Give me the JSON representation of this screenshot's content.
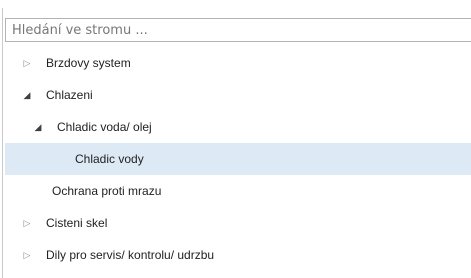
{
  "search": {
    "placeholder": "Hledání ve stromu ..."
  },
  "tree": {
    "rows": [
      {
        "label": "Brzdovy system",
        "expander": "▷"
      },
      {
        "label": "Chlazeni",
        "expander": "◢"
      },
      {
        "label": "Chladic voda/ olej",
        "expander": "◢"
      },
      {
        "label": "Chladic vody",
        "expander": ""
      },
      {
        "label": "Ochrana proti mrazu",
        "expander": ""
      },
      {
        "label": "Cisteni skel",
        "expander": "▷"
      },
      {
        "label": "Dily pro servis/ kontrolu/ udrzbu",
        "expander": "▷"
      }
    ]
  },
  "colors": {
    "selected_row": "#ddeaf5",
    "input_border": "#b4b4b4",
    "text": "#222222",
    "placeholder": "#777777"
  }
}
